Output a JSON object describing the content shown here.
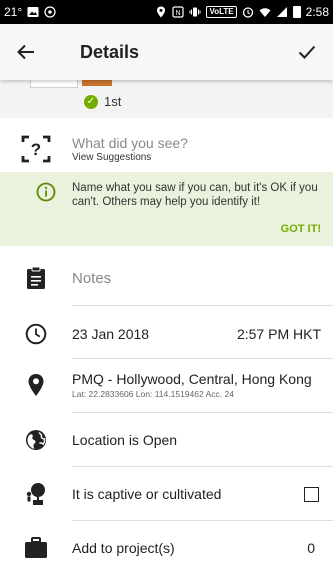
{
  "status_bar": {
    "left_text": "21°",
    "right_text": "2:58",
    "volte": "VoLTE",
    "icons": [
      "image-icon",
      "whatsapp-icon",
      "location-icon",
      "nfc-icon",
      "vibrate-icon",
      "alarm-icon",
      "wifi-icon",
      "signal-icon",
      "battery-icon"
    ]
  },
  "app_bar": {
    "title": "Details",
    "back_icon": "arrow-back-icon",
    "confirm_icon": "check-icon"
  },
  "taxon": {
    "rank_badge": "1st"
  },
  "what_you_saw": {
    "title": "What did you see?",
    "subtitle": "View Suggestions"
  },
  "tip": {
    "text": "Name what you saw if you can, but it's OK if you can't. Others may help you identify it!",
    "action": "GOT IT!"
  },
  "notes": {
    "placeholder": "Notes"
  },
  "datetime": {
    "date": "23 Jan 2018",
    "time": "2:57 PM HKT"
  },
  "location": {
    "name": "PMQ - Hollywood, Central, Hong Kong",
    "coords": "Lat: 22.2833606 Lon: 114.1519462 Acc. 24"
  },
  "geoprivacy": {
    "label": "Location is Open"
  },
  "captive": {
    "label": "It is captive or cultivated",
    "checked": false
  },
  "projects": {
    "label": "Add to project(s)",
    "count": "0"
  },
  "colors": {
    "accent": "#74ac00",
    "tip_bg": "#eaf1dc"
  }
}
